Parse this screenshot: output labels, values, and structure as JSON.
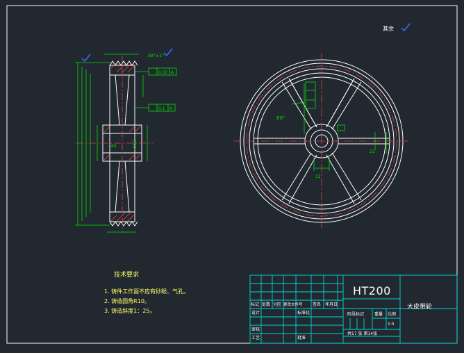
{
  "drawing": {
    "roughness_symbol": "其余",
    "material": "HT200",
    "part_name": "大皮带轮",
    "scale": "1:5",
    "sheet_info": "共17 张 第14张"
  },
  "tech_requirements": {
    "title": "技术要求",
    "items": [
      "1. 铸件工作面不应有砂眼、气孔。",
      "2. 铸造圆角R10。",
      "3. 铸造斜度1：25。"
    ]
  },
  "title_block": {
    "row_labels": [
      "标记",
      "处数",
      "分区",
      "更改文件号",
      "签名",
      "年月日"
    ],
    "design": "设计",
    "standardize": "标准化",
    "review": "审核",
    "process": "工艺",
    "approve": "批准",
    "stage_mark": "阶段标记",
    "weight": "重量",
    "ratio": "比例"
  },
  "dims": {
    "left_view": {
      "top_angle": "38°±1°",
      "tol_1": "0.02",
      "tol_2": "0.1",
      "label_a": "A",
      "angle_small": "60",
      "bore": "Φ58"
    },
    "right_view": {
      "angle": "60°",
      "keyway": "12",
      "width": "21"
    }
  }
}
